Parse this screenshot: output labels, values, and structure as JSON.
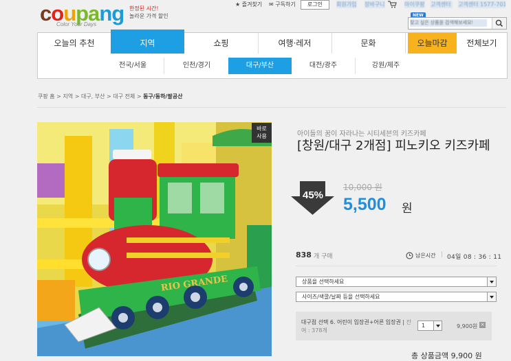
{
  "header": {
    "logo": {
      "parts": [
        "c",
        "o",
        "u",
        "pa",
        "ng"
      ],
      "sub": "Color Your Days"
    },
    "tagline": {
      "line1": "한정된 시간!",
      "line2": "놀라운 가격 할인"
    },
    "links": {
      "favorite": "즐겨찾기",
      "subscribe": "구독하기",
      "login": "로그인"
    },
    "blurred_links": [
      "회원가입",
      "장바구니",
      "마이쿠팡",
      "고객센터",
      "고객센터 1577-7011"
    ],
    "new_badge": "NEW",
    "search": {
      "placeholder": "찾고 싶은 상품을 검색해보세요!"
    }
  },
  "nav": {
    "tabs": [
      "오늘의 추천",
      "지역",
      "쇼핑",
      "여행·레저",
      "문화",
      "오늘마감",
      "전체보기"
    ],
    "active_tab": "지역",
    "sub_tabs": [
      "전국/서울",
      "인천/경기",
      "대구/부산",
      "대전/광주",
      "강원/제주"
    ],
    "active_sub_tab": "대구/부산"
  },
  "breadcrumb": {
    "items": [
      "쿠팡 홈",
      "지역",
      "대구, 부산",
      "대구 전체"
    ],
    "current": "동구/동하/팔공산",
    "separator": ">"
  },
  "product": {
    "now_badge": [
      "바로",
      "사용"
    ],
    "image_sign": "RIO GRANDE",
    "subtitle": "아이들의 꿈이 자라나는 시티세븐의 키즈카페",
    "title": "[창원/대구 2개점] 피노키오 키즈카페",
    "discount": "45%",
    "original_price": "10,000 원",
    "price": "5,500",
    "price_unit": "원",
    "sold_count": "838",
    "sold_label": "개 구매",
    "time_label": "남은시간",
    "time_separator": "|",
    "time_value": "04일  08 : 36 : 11",
    "select1": "상품을 선택하세요",
    "select2": "사이즈/색깔/날짜 등을 선택하세요",
    "option": {
      "name": "대구점 선택 6. 어린이 입장권+어른 입장권 |",
      "stock": "잔여 : 378개",
      "qty": "1",
      "price": "9,900원",
      "remove": "×"
    },
    "total": "총 상품금액  9,900 원"
  },
  "colors": {
    "accent_blue": "#1e9ee3",
    "price_blue": "#1e8fe0",
    "closing_tab": "#f7b21d"
  }
}
